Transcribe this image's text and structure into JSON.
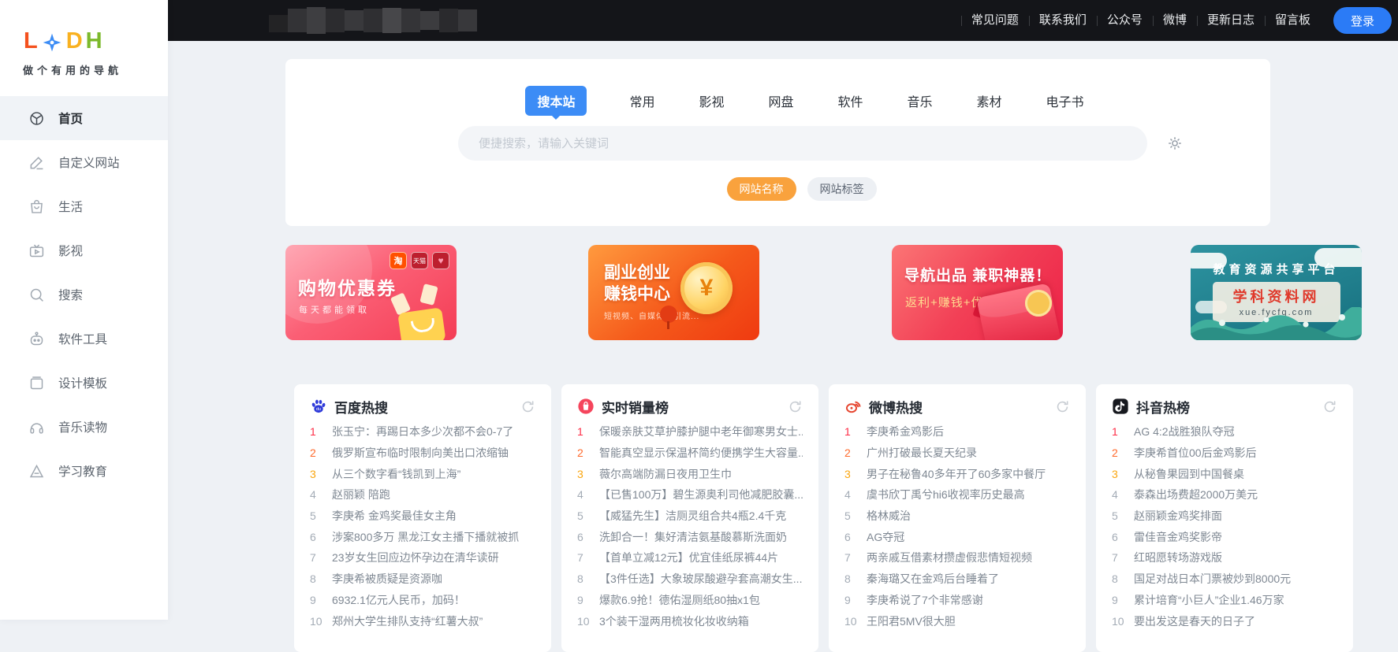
{
  "topbar": {
    "links": [
      "常见问题",
      "联系我们",
      "公众号",
      "微博",
      "更新日志",
      "留言板"
    ],
    "login_label": "登录"
  },
  "sidebar": {
    "logo_letters": {
      "l": "L",
      "d": "D",
      "h": "H"
    },
    "tagline": "做个有用的导航",
    "items": [
      {
        "label": "首页",
        "active": true
      },
      {
        "label": "自定义网站"
      },
      {
        "label": "生活"
      },
      {
        "label": "影视"
      },
      {
        "label": "搜索"
      },
      {
        "label": "软件工具"
      },
      {
        "label": "设计模板"
      },
      {
        "label": "音乐读物"
      },
      {
        "label": "学习教育"
      }
    ]
  },
  "search": {
    "tabs": [
      {
        "label": "搜本站",
        "active": true
      },
      {
        "label": "常用"
      },
      {
        "label": "影视"
      },
      {
        "label": "网盘"
      },
      {
        "label": "软件"
      },
      {
        "label": "音乐"
      },
      {
        "label": "素材"
      },
      {
        "label": "电子书"
      }
    ],
    "placeholder": "便捷搜索，请输入关键词",
    "filter_buttons": [
      {
        "label": "网站名称",
        "variant": "orange"
      },
      {
        "label": "网站标签",
        "variant": "gray"
      }
    ]
  },
  "banners": {
    "shopping": {
      "title": "购物优惠券",
      "subtitle": "每天都能领取",
      "badges": [
        "淘",
        "天猫",
        "♥"
      ]
    },
    "sideline": {
      "title_line1": "副业创业",
      "title_line2": "赚钱中心",
      "subtitle": "短视频、自媒体、引流...",
      "coin_symbol": "¥"
    },
    "parttime": {
      "title": "导航出品 兼职神器！",
      "subtitle": "返利+赚钱+优惠券"
    },
    "edu": {
      "title": "教育资源共享平台",
      "brand": "学科资料网",
      "url": "xue.fycfg.com"
    }
  },
  "hotlists": [
    {
      "title": "百度热搜",
      "items": [
        {
          "rank": 1,
          "text": "张玉宁：再踢日本多少次都不会0-7了"
        },
        {
          "rank": 2,
          "text": "俄罗斯宣布临时限制向美出口浓缩铀"
        },
        {
          "rank": 3,
          "text": "从三个数字看“钱凯到上海”"
        },
        {
          "rank": 4,
          "text": "赵丽颖 陪跑"
        },
        {
          "rank": 5,
          "text": "李庚希 金鸡奖最佳女主角"
        },
        {
          "rank": 6,
          "text": "涉案800多万 黑龙江女主播下播就被抓"
        },
        {
          "rank": 7,
          "text": "23岁女生回应边怀孕边在清华读研"
        },
        {
          "rank": 8,
          "text": "李庚希被质疑是资源咖"
        },
        {
          "rank": 9,
          "text": "6932.1亿元人民币，加码！"
        },
        {
          "rank": 10,
          "text": "郑州大学生排队支持“红薯大叔”"
        }
      ]
    },
    {
      "title": "实时销量榜",
      "items": [
        {
          "rank": 1,
          "text": "保暖亲肤艾草护膝护腿中老年御寒男女士..."
        },
        {
          "rank": 2,
          "text": "智能真空显示保温杯简约便携学生大容量..."
        },
        {
          "rank": 3,
          "text": "薇尔高端防漏日夜用卫生巾"
        },
        {
          "rank": 4,
          "text": "【已售100万】碧生源奥利司他减肥胶囊..."
        },
        {
          "rank": 5,
          "text": "【威猛先生】洁厕灵组合共4瓶2.4千克"
        },
        {
          "rank": 6,
          "text": "洗卸合一！集好清洁氨基酸慕斯洗面奶"
        },
        {
          "rank": 7,
          "text": "【首单立减12元】优宜佳纸尿裤44片"
        },
        {
          "rank": 8,
          "text": "【3件任选】大象玻尿酸避孕套高潮女生..."
        },
        {
          "rank": 9,
          "text": "爆款6.9抢！德佑湿厕纸80抽x1包"
        },
        {
          "rank": 10,
          "text": "3个装干湿两用梳妆化妆收纳箱"
        }
      ]
    },
    {
      "title": "微博热搜",
      "items": [
        {
          "rank": 1,
          "text": "李庚希金鸡影后"
        },
        {
          "rank": 2,
          "text": "广州打破最长夏天纪录"
        },
        {
          "rank": 3,
          "text": "男子在秘鲁40多年开了60多家中餐厅"
        },
        {
          "rank": 4,
          "text": "虞书欣丁禹兮hi6收视率历史最高"
        },
        {
          "rank": 5,
          "text": "格林威治"
        },
        {
          "rank": 6,
          "text": "AG夺冠"
        },
        {
          "rank": 7,
          "text": "两亲戚互借素材攒虚假悲情短视频"
        },
        {
          "rank": 8,
          "text": "秦海璐又在金鸡后台睡着了"
        },
        {
          "rank": 9,
          "text": "李庚希说了7个非常感谢"
        },
        {
          "rank": 10,
          "text": "王阳君5MV很大胆"
        }
      ]
    },
    {
      "title": "抖音热榜",
      "items": [
        {
          "rank": 1,
          "text": "AG 4:2战胜狼队夺冠"
        },
        {
          "rank": 2,
          "text": "李庚希首位00后金鸡影后"
        },
        {
          "rank": 3,
          "text": "从秘鲁果园到中国餐桌"
        },
        {
          "rank": 4,
          "text": "泰森出场费超2000万美元"
        },
        {
          "rank": 5,
          "text": "赵丽颖金鸡奖排面"
        },
        {
          "rank": 6,
          "text": "雷佳音金鸡奖影帝"
        },
        {
          "rank": 7,
          "text": "红昭愿转场游戏版"
        },
        {
          "rank": 8,
          "text": "国足对战日本门票被炒到8000元"
        },
        {
          "rank": 9,
          "text": "累计培育“小巨人”企业1.46万家"
        },
        {
          "rank": 10,
          "text": "要出发这是春天的日子了"
        }
      ]
    }
  ],
  "colors": {
    "accent_blue": "#3c8cf6",
    "login_blue": "#2b7bf6",
    "rank1": "#fe2d46",
    "rank2": "#ff6a2c",
    "rank3": "#faa60f",
    "orange_button": "#f9a23d",
    "topbar_bg": "#141519",
    "page_bg": "#eef1f5"
  }
}
